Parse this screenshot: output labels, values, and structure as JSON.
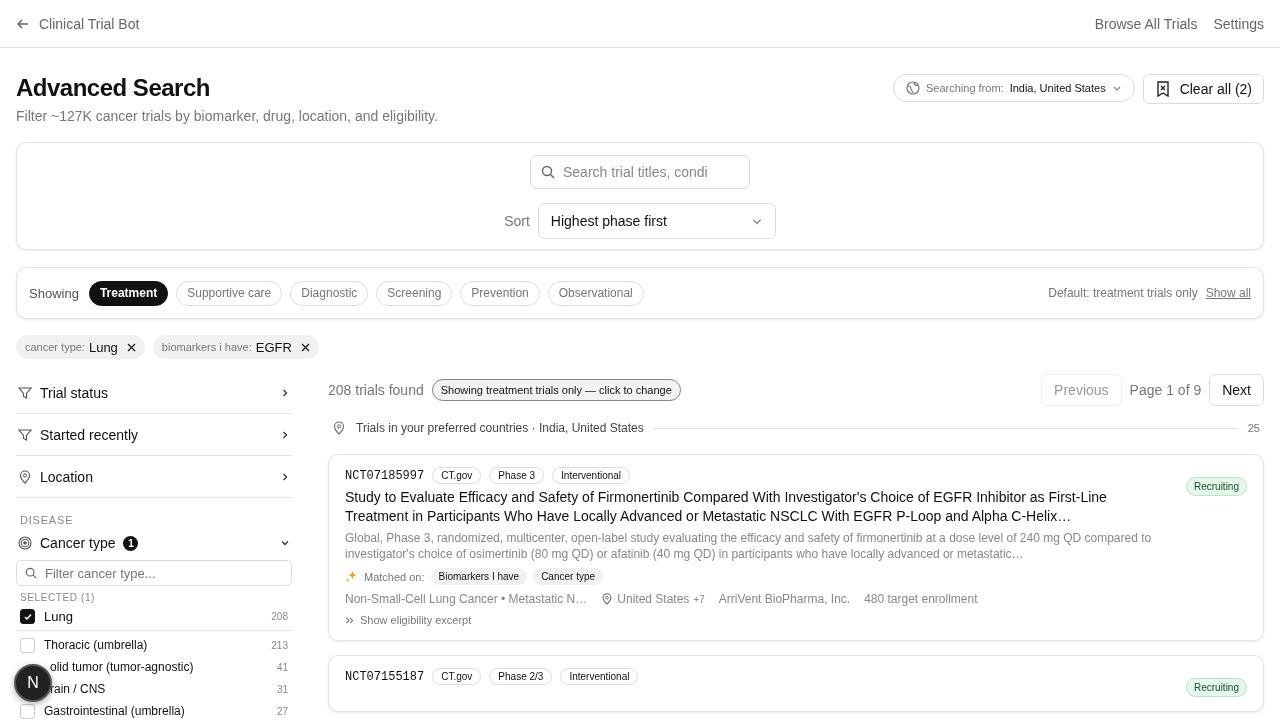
{
  "header": {
    "back_label": "Clinical Trial Bot",
    "links": [
      "Browse All Trials",
      "Settings"
    ]
  },
  "page": {
    "title": "Advanced Search",
    "subtitle": "Filter ~127K cancer trials by biomarker, drug, location, and eligibility.",
    "searching_label": "Searching from:",
    "searching_value": "India, United States",
    "clear_button": "Clear all (2)"
  },
  "search": {
    "placeholder": "Search trial titles, condi",
    "sort_label": "Sort",
    "sort_value": "Highest phase first"
  },
  "categories": {
    "label": "Showing",
    "items": [
      {
        "label": "Treatment",
        "selected": true
      },
      {
        "label": "Supportive care",
        "selected": false
      },
      {
        "label": "Diagnostic",
        "selected": false
      },
      {
        "label": "Screening",
        "selected": false
      },
      {
        "label": "Prevention",
        "selected": false
      },
      {
        "label": "Observational",
        "selected": false
      }
    ],
    "note": "Default: treatment trials only",
    "link": "Show all"
  },
  "active_filters": [
    {
      "key": "cancer type:",
      "value": "Lung"
    },
    {
      "key": "biomarkers i have:",
      "value": "EGFR"
    }
  ],
  "sidebar": {
    "sections": [
      {
        "label": "Trial status"
      },
      {
        "label": "Started recently"
      },
      {
        "label": "Location"
      }
    ],
    "group_label": "DISEASE",
    "cancer_type": {
      "label": "Cancer type",
      "badge": "1",
      "expanded": true,
      "filter_placeholder": "Filter cancer type...",
      "selected_label": "SELECTED (1)",
      "selected_options": [
        {
          "label": "Lung",
          "count": "208",
          "checked": true
        }
      ],
      "options": [
        {
          "label": "Thoracic (umbrella)",
          "count": "213",
          "checked": false
        },
        {
          "label": "olid tumor (tumor-agnostic)",
          "count": "41"
        },
        {
          "label": "rain / CNS",
          "count": "31"
        },
        {
          "label": "Gastrointestinal (umbrella)",
          "count": "27",
          "checked": false
        }
      ]
    }
  },
  "results": {
    "count": "208 trials found",
    "mode_chip": "Showing treatment trials only — click to change",
    "pagination": {
      "previous": "Previous",
      "previous_disabled": true,
      "page": "Page 1 of 9",
      "next": "Next"
    },
    "group": {
      "label": "Trials in your preferred countries · India, United States",
      "count": "25"
    },
    "trials": [
      {
        "id": "NCT07185997",
        "tags": [
          "CT.gov",
          "Phase 3",
          "Interventional"
        ],
        "status": "Recruiting",
        "title": "Study to Evaluate Efficacy and Safety of Firmonertinib Compared With Investigator's Choice of EGFR Inhibitor as First-Line Treatment in Participants Who Have Locally Advanced or Metastatic NSCLC With EGFR P-Loop and Alpha C-Helix…",
        "summary": "Global, Phase 3, randomized, multicenter, open-label study evaluating the efficacy and safety of firmonertinib at a dose level of 240 mg QD compared to investigator's choice of osimertinib (80 mg QD) or afatinib (40 mg QD) in participants who have locally advanced or metastatic…",
        "matched_label": "Matched on:",
        "matched": [
          "Biomarkers I have",
          "Cancer type"
        ],
        "condition": "Non-Small-Cell Lung Cancer • Metastatic N…",
        "location": "United States",
        "location_more": "+7",
        "sponsor": "ArriVent BioPharma, Inc.",
        "enrollment": "480 target enrollment",
        "excerpt_toggle": "Show eligibility excerpt"
      },
      {
        "id": "NCT07155187",
        "tags": [
          "CT.gov",
          "Phase 2/3",
          "Interventional"
        ],
        "status": "Recruiting"
      }
    ]
  },
  "avatar": {
    "initial": "N"
  }
}
